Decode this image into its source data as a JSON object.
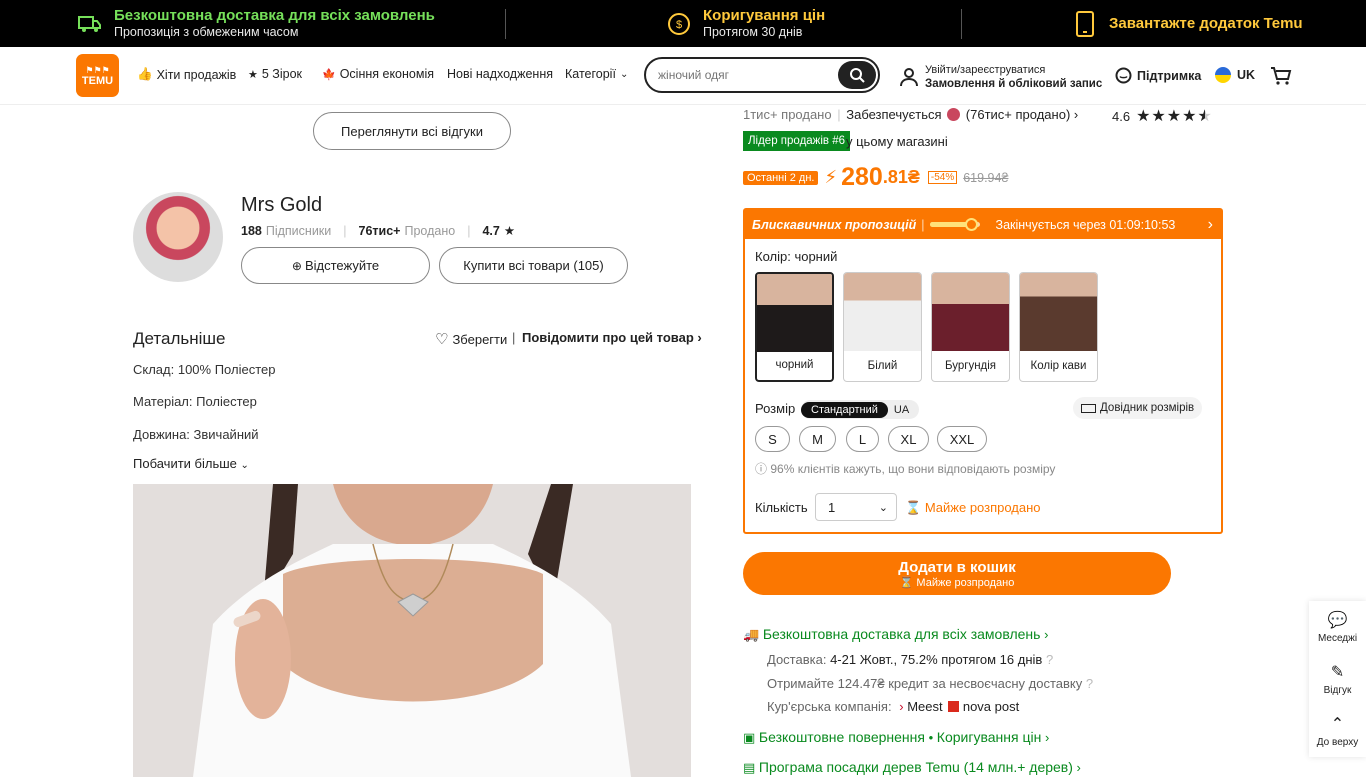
{
  "promo": {
    "shipping_title": "Безкоштовна доставка для всіх замовлень",
    "shipping_sub": "Пропозиція з обмеженим часом",
    "price_title": "Коригування цін",
    "price_sub": "Протягом 30 днів",
    "app_title": "Завантажте додаток Temu"
  },
  "header": {
    "logo_text": "TEMU",
    "nav": [
      "Хіти продажів",
      "5 Зірок",
      "Осіння економія",
      "Нові надходження",
      "Категорії"
    ],
    "search_placeholder": "жіночий одяг",
    "account_line1": "Увійти/зареєструватися",
    "account_line2": "Замовлення й обліковий запис",
    "support": "Підтримка",
    "language": "UK"
  },
  "reviews": {
    "view_all": "Переглянути всі відгуки"
  },
  "store": {
    "name": "Mrs Gold",
    "followers_count": "188",
    "followers_label": "Підписники",
    "sold_count": "76тис+",
    "sold_label": "Продано",
    "rating": "4.7",
    "follow_button": "Відстежуйте",
    "buy_all_button": "Купити всі товари (105)"
  },
  "details": {
    "title": "Детальніше",
    "save": "Зберегти",
    "report": "Повідомити про цей товар",
    "composition": "Склад: 100% Поліестер",
    "material": "Матеріал: Поліестер",
    "length": "Довжина: Звичайний",
    "see_more": "Побачити більше"
  },
  "product": {
    "sold_line": "1тис+ продано",
    "secured_line": "Забезпечується",
    "secured_sold": "(76тис+ продано)",
    "rating": "4.6",
    "stars_value": 4.5,
    "leader_badge": "Лідер продажів #6",
    "leader_suffix": "у цьому магазині",
    "last_days": "Останні 2 дн.",
    "price_main": "280",
    "price_cents": ".81₴",
    "discount": "-54%",
    "old_price": "619.94₴"
  },
  "flash": {
    "label": "Блискавичних пропозицій",
    "progress": 0.85,
    "ends": "Закінчується через 01:09:10:53",
    "color_label": "Колір: чорний",
    "colors": [
      {
        "name": "чорний",
        "hex": "#1e1a1a"
      },
      {
        "name": "Білий",
        "hex": "#eeeeee"
      },
      {
        "name": "Бургундія",
        "hex": "#6b1f2c"
      },
      {
        "name": "Колір кави",
        "hex": "#5a3a2e"
      }
    ],
    "size_label": "Розмір",
    "size_standard": "Стандартний",
    "size_ua": "UA",
    "size_guide": "Довідник розмірів",
    "sizes": [
      "S",
      "M",
      "L",
      "XL",
      "XXL"
    ],
    "fit_note": "96% клієнтів кажуть, що вони відповідають розміру",
    "qty_label": "Кількість",
    "qty_value": "1",
    "almost_sold": "Майже розпродано"
  },
  "cart": {
    "add": "Додати в кошик",
    "sub": "Майже розпродано"
  },
  "shipping": {
    "free_title": "Безкоштовна доставка для всіх замовлень",
    "delivery_label": "Доставка:",
    "delivery_value": "4-21 Жовт., 75.2% протягом 16 днів",
    "credit": "Отримайте 124.47₴ кредит за несвоєчасну доставку",
    "courier_label": "Кур'єрська компанія:",
    "courier_1": "Meest",
    "courier_2": "nova post",
    "returns": "Безкоштовне повернення",
    "returns_sep": "•",
    "price_adjust": "Коригування цін",
    "trees": "Програма посадки дерев Temu (14 млн.+ дерев)"
  },
  "side_tools": {
    "messages": "Меседжі",
    "review": "Відгук",
    "top": "До верху"
  },
  "colors": {
    "brand_orange": "#fb7701",
    "green": "#0a8a1f",
    "promo_green": "#76e05a",
    "promo_gold": "#ffc93c"
  }
}
